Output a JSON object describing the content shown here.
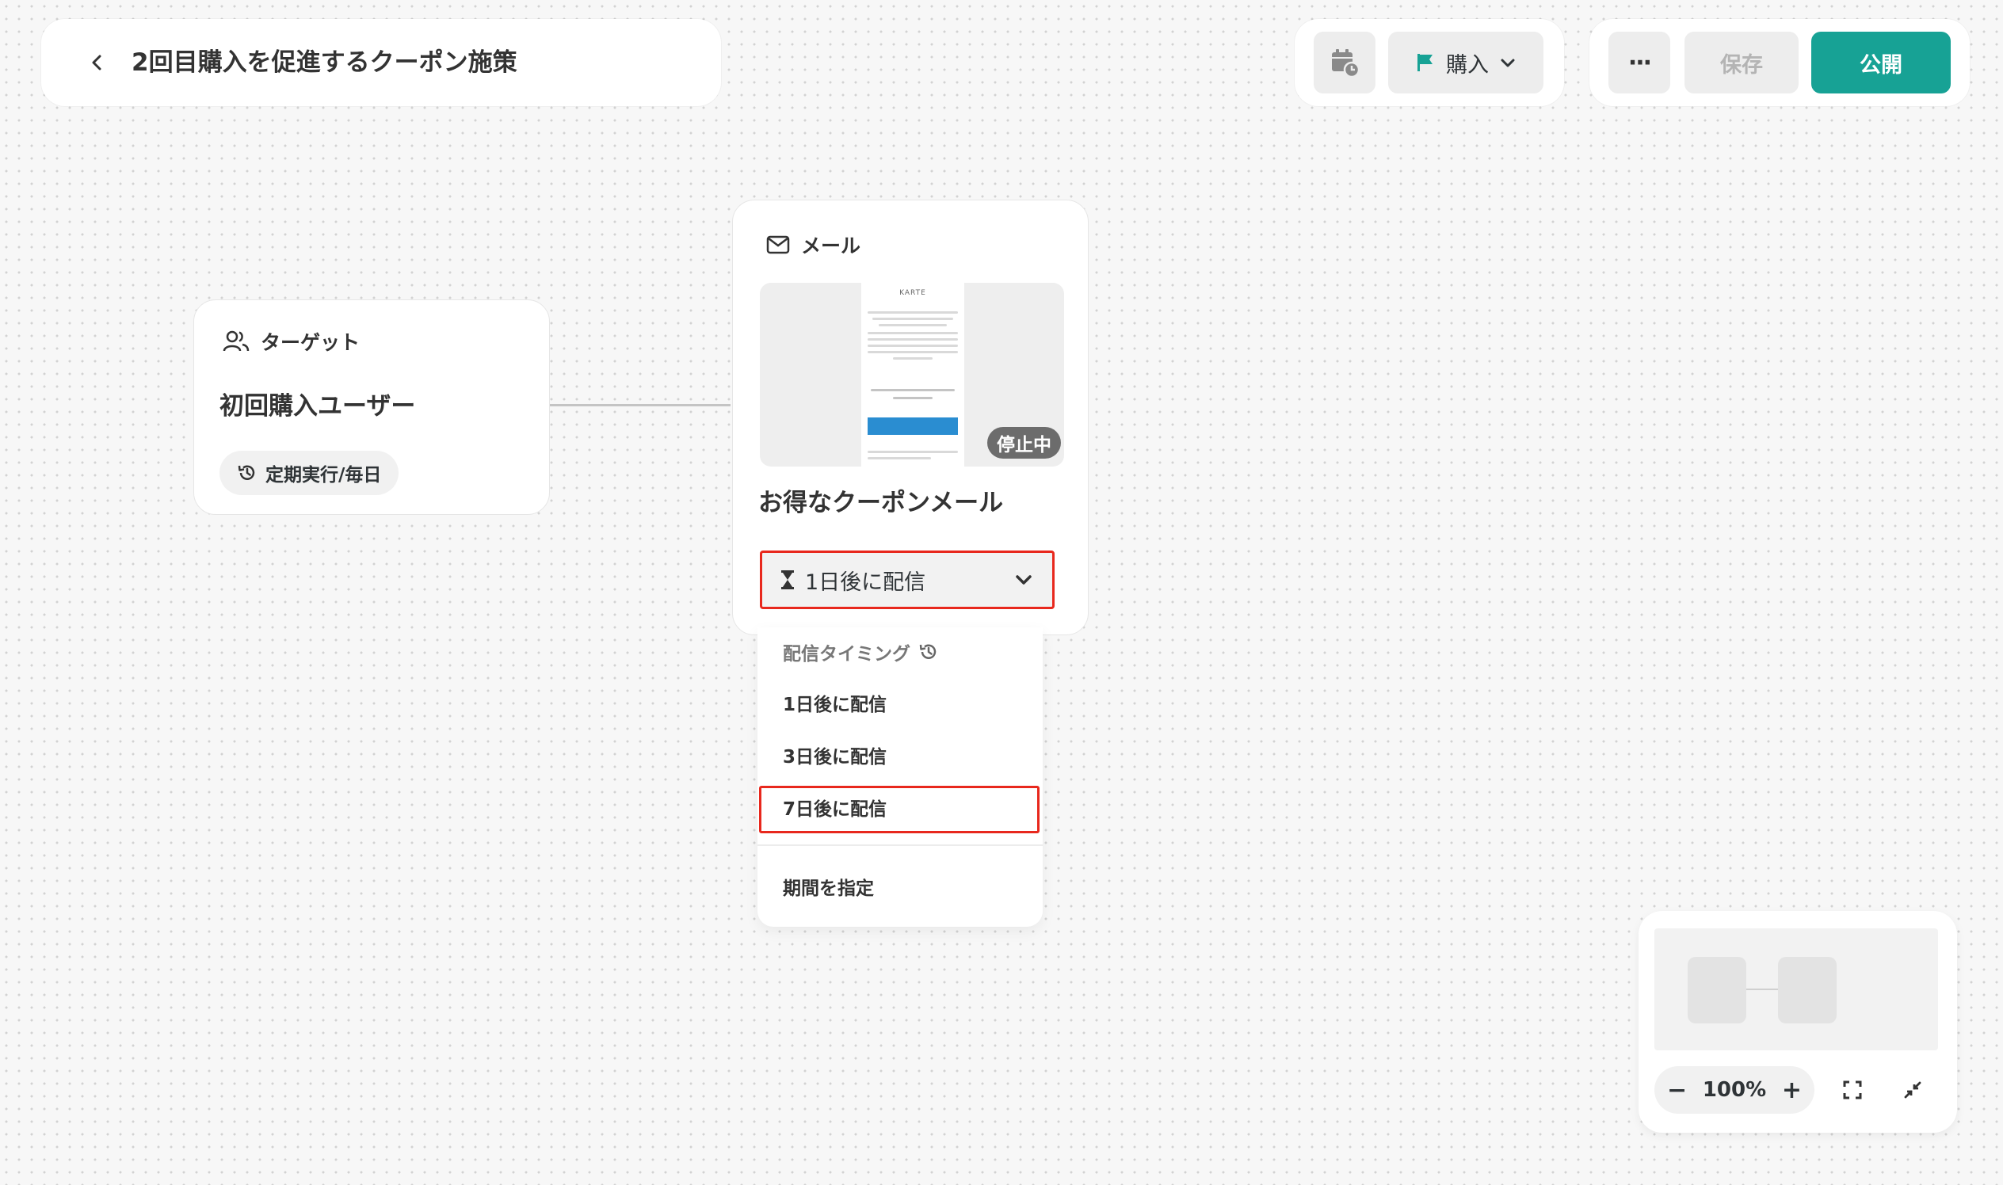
{
  "header": {
    "title": "2回目購入を促進するクーポン施策",
    "back_icon": "chevron-left-icon"
  },
  "toolbar": {
    "schedule_icon": "calendar-clock-icon",
    "goal_icon": "flag-icon",
    "goal_label": "購入",
    "more_label": "···",
    "save_label": "保存",
    "publish_label": "公開",
    "accent_color": "#17a295"
  },
  "target_node": {
    "type_label": "ターゲット",
    "type_icon": "users-icon",
    "name": "初回購入ユーザー",
    "schedule_icon": "history-icon",
    "schedule_label": "定期実行/毎日"
  },
  "mail_node": {
    "type_label": "メール",
    "type_icon": "mail-icon",
    "preview_logo": "KARTE",
    "status_badge": "停止中",
    "name": "お得なクーポンメール",
    "timing_icon": "hourglass-icon",
    "timing_value": "1日後に配信",
    "timing_chevron": "chevron-down-icon"
  },
  "timing_dropdown": {
    "header": "配信タイミング",
    "header_icon": "history-icon",
    "options": [
      "1日後に配信",
      "3日後に配信",
      "7日後に配信"
    ],
    "highlighted_option": "7日後に配信",
    "custom_option": "期間を指定"
  },
  "minimap": {
    "zoom_level": "100%",
    "zoom_out_label": "−",
    "zoom_in_label": "+",
    "fit_icon": "fit-screen-icon",
    "collapse_icon": "collapse-icon"
  },
  "colors": {
    "highlight_border": "#e8281d",
    "publish_bg": "#17a295",
    "flag": "#17a295"
  }
}
